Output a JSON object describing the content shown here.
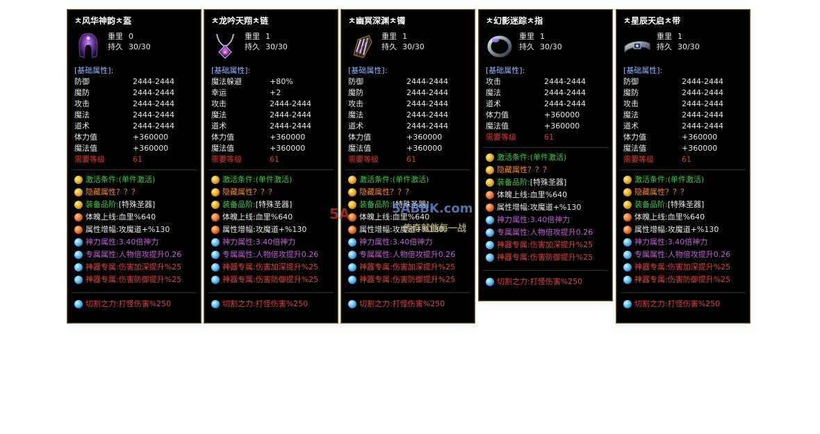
{
  "labels": {
    "weight": "重里",
    "durability": "持久",
    "base_header": "[基础属性]:"
  },
  "colors": {
    "panel_bg": "#000000",
    "border": "#7a5a28",
    "header": "#8fb4ff",
    "green": "#36d43c",
    "orange": "#ff8a1a",
    "purple": "#c75ae0",
    "red": "#e5423a"
  },
  "watermark": {
    "url": "5ABBK.com",
    "logo": "5A",
    "slogan": "传奇就能每一战"
  },
  "items": [
    {
      "title": "ㅊ风华神韵ㅊ盔",
      "icon": "helmet-icon",
      "weight": "0",
      "durability": "30/30",
      "base": [
        {
          "k": "防御",
          "v": "2444-2444"
        },
        {
          "k": "魔防",
          "v": "2444-2444"
        },
        {
          "k": "攻击",
          "v": "2444-2444"
        },
        {
          "k": "魔法",
          "v": "2444-2444"
        },
        {
          "k": "道术",
          "v": "2444-2444"
        },
        {
          "k": "体力值",
          "v": "+360000"
        },
        {
          "k": "魔法值",
          "v": "+360000"
        }
      ],
      "req": {
        "k": "需要等级",
        "v": "61"
      },
      "specials": [
        {
          "orb": "gold",
          "label": "激活条件:",
          "value": "(单件激活)",
          "lc": "c-green",
          "vc": "c-green"
        },
        {
          "orb": "gold",
          "label": "隐藏属性",
          "value": "？？？",
          "lc": "c-orange",
          "vc": "c-orange"
        },
        {
          "orb": "gold",
          "label": "装备品阶:",
          "value": "[特殊圣器]",
          "lc": "c-green",
          "vc": "c-white"
        },
        {
          "orb": "orange",
          "label": "体魄上线:",
          "value": "血里%640",
          "lc": "c-white",
          "vc": "c-white"
        },
        {
          "orb": "orange",
          "label": "属性增幅:",
          "value": "攻魔道+%130",
          "lc": "c-white",
          "vc": "c-white"
        },
        {
          "orb": "blue",
          "label": "神力属性:",
          "value": "3.40倍神力",
          "lc": "c-purple",
          "vc": "c-purple"
        },
        {
          "orb": "blue",
          "label": "专属属性:",
          "value": "人物倍攻提升0.26",
          "lc": "c-purple",
          "vc": "c-purple"
        },
        {
          "orb": "blue",
          "label": "神器专属:",
          "value": "伤害加深提升%25",
          "lc": "c-red",
          "vc": "c-red"
        },
        {
          "orb": "blue",
          "label": "神器专属:",
          "value": "伤害防御提升%25",
          "lc": "c-red",
          "vc": "c-red"
        }
      ],
      "cut": {
        "label": "切割之力:",
        "value": "打怪伤害%250"
      }
    },
    {
      "title": "ㅊ龙吟天翔ㅊ链",
      "icon": "necklace-icon",
      "weight": "1",
      "durability": "30/30",
      "base": [
        {
          "k": "魔法躲避",
          "v": "+80%"
        },
        {
          "k": "幸运",
          "v": "+2"
        },
        {
          "k": "攻击",
          "v": "2444-2444"
        },
        {
          "k": "魔法",
          "v": "2444-2444"
        },
        {
          "k": "道术",
          "v": "2444-2444"
        },
        {
          "k": "体力值",
          "v": "+360000"
        },
        {
          "k": "魔法值",
          "v": "+360000"
        }
      ],
      "req": {
        "k": "需要等级",
        "v": "61"
      },
      "specials": [
        {
          "orb": "gold",
          "label": "激活条件:",
          "value": "(单件激活)",
          "lc": "c-green",
          "vc": "c-green"
        },
        {
          "orb": "gold",
          "label": "隐藏属性",
          "value": "？？？",
          "lc": "c-orange",
          "vc": "c-orange"
        },
        {
          "orb": "gold",
          "label": "装备品阶:",
          "value": "[特殊圣器]",
          "lc": "c-green",
          "vc": "c-white"
        },
        {
          "orb": "orange",
          "label": "体魄上线:",
          "value": "血里%640",
          "lc": "c-white",
          "vc": "c-white"
        },
        {
          "orb": "orange",
          "label": "属性增幅:",
          "value": "攻魔道+%130",
          "lc": "c-white",
          "vc": "c-white"
        },
        {
          "orb": "blue",
          "label": "神力属性:",
          "value": "3.40倍神力",
          "lc": "c-purple",
          "vc": "c-purple"
        },
        {
          "orb": "blue",
          "label": "专属属性:",
          "value": "人物倍攻提升0.26",
          "lc": "c-purple",
          "vc": "c-purple"
        },
        {
          "orb": "blue",
          "label": "神器专属:",
          "value": "伤害加深提升%25",
          "lc": "c-red",
          "vc": "c-red"
        },
        {
          "orb": "blue",
          "label": "神器专属:",
          "value": "伤害防御提升%25",
          "lc": "c-red",
          "vc": "c-red"
        }
      ],
      "cut": {
        "label": "切割之力:",
        "value": "打怪伤害%250"
      }
    },
    {
      "title": "ㅊ幽冥深渊ㅊ镯",
      "icon": "bracelet-icon",
      "weight": "1",
      "durability": "30/30",
      "base": [
        {
          "k": "防御",
          "v": "2444-2444"
        },
        {
          "k": "魔防",
          "v": "2444-2444"
        },
        {
          "k": "攻击",
          "v": "2444-2444"
        },
        {
          "k": "魔法",
          "v": "2444-2444"
        },
        {
          "k": "道术",
          "v": "2444-2444"
        },
        {
          "k": "体力值",
          "v": "+360000"
        },
        {
          "k": "魔法值",
          "v": "+360000"
        }
      ],
      "req": {
        "k": "需要等级",
        "v": "61"
      },
      "specials": [
        {
          "orb": "gold",
          "label": "激活条件:",
          "value": "(单件激活)",
          "lc": "c-green",
          "vc": "c-green"
        },
        {
          "orb": "gold",
          "label": "隐藏属性",
          "value": "？？？",
          "lc": "c-orange",
          "vc": "c-orange"
        },
        {
          "orb": "gold",
          "label": "装备品阶:",
          "value": "[特殊圣器]",
          "lc": "c-green",
          "vc": "c-white"
        },
        {
          "orb": "orange",
          "label": "体魄上线:",
          "value": "血里%640",
          "lc": "c-white",
          "vc": "c-white"
        },
        {
          "orb": "orange",
          "label": "属性增幅:",
          "value": "攻魔道+%130",
          "lc": "c-white",
          "vc": "c-white"
        },
        {
          "orb": "blue",
          "label": "神力属性:",
          "value": "3.40倍神力",
          "lc": "c-purple",
          "vc": "c-purple"
        },
        {
          "orb": "blue",
          "label": "专属属性:",
          "value": "人物倍攻提升0.26",
          "lc": "c-purple",
          "vc": "c-purple"
        },
        {
          "orb": "blue",
          "label": "神器专属:",
          "value": "伤害加深提升%25",
          "lc": "c-red",
          "vc": "c-red"
        },
        {
          "orb": "blue",
          "label": "神器专属:",
          "value": "伤害防御提升%25",
          "lc": "c-red",
          "vc": "c-red"
        }
      ],
      "cut": {
        "label": "切割之力:",
        "value": "打怪伤害%250"
      }
    },
    {
      "title": "ㅊ幻影迷踪ㅊ指",
      "icon": "ring-icon",
      "weight": "1",
      "durability": "30/30",
      "base": [
        {
          "k": "攻击",
          "v": "2444-2444"
        },
        {
          "k": "魔法",
          "v": "2444-2444"
        },
        {
          "k": "道术",
          "v": "2444-2444"
        },
        {
          "k": "体力值",
          "v": "+360000"
        },
        {
          "k": "魔法值",
          "v": "+360000"
        }
      ],
      "req": {
        "k": "需要等级",
        "v": "61"
      },
      "specials": [
        {
          "orb": "gold",
          "label": "激活条件:",
          "value": "(单件激活)",
          "lc": "c-green",
          "vc": "c-green"
        },
        {
          "orb": "gold",
          "label": "隐藏属性",
          "value": "？？？",
          "lc": "c-orange",
          "vc": "c-orange"
        },
        {
          "orb": "gold",
          "label": "装备品阶:",
          "value": "[特殊圣器]",
          "lc": "c-green",
          "vc": "c-white"
        },
        {
          "orb": "orange",
          "label": "体魄上线:",
          "value": "血里%640",
          "lc": "c-white",
          "vc": "c-white"
        },
        {
          "orb": "orange",
          "label": "属性增幅:",
          "value": "攻魔道+%130",
          "lc": "c-white",
          "vc": "c-white"
        },
        {
          "orb": "blue",
          "label": "神力属性:",
          "value": "3.40倍神力",
          "lc": "c-purple",
          "vc": "c-purple"
        },
        {
          "orb": "blue",
          "label": "专属属性:",
          "value": "人物倍攻提升0.26",
          "lc": "c-purple",
          "vc": "c-purple"
        },
        {
          "orb": "blue",
          "label": "神器专属:",
          "value": "伤害加深提升%25",
          "lc": "c-red",
          "vc": "c-red"
        },
        {
          "orb": "blue",
          "label": "神器专属:",
          "value": "伤害防御提升%25",
          "lc": "c-red",
          "vc": "c-red"
        }
      ],
      "cut": {
        "label": "切割之力:",
        "value": "打怪伤害%250"
      }
    },
    {
      "title": "ㅊ星辰天启ㅊ带",
      "icon": "belt-icon",
      "weight": "1",
      "durability": "30/30",
      "base": [
        {
          "k": "防御",
          "v": "2444-2444"
        },
        {
          "k": "魔防",
          "v": "2444-2444"
        },
        {
          "k": "攻击",
          "v": "2444-2444"
        },
        {
          "k": "魔法",
          "v": "2444-2444"
        },
        {
          "k": "道术",
          "v": "2444-2444"
        },
        {
          "k": "体力值",
          "v": "+360000"
        },
        {
          "k": "魔法值",
          "v": "+360000"
        }
      ],
      "req": {
        "k": "需要等级",
        "v": "61"
      },
      "specials": [
        {
          "orb": "gold",
          "label": "激活条件:",
          "value": "(单件激活)",
          "lc": "c-green",
          "vc": "c-green"
        },
        {
          "orb": "gold",
          "label": "隐藏属性",
          "value": "？？？",
          "lc": "c-orange",
          "vc": "c-orange"
        },
        {
          "orb": "gold",
          "label": "装备品阶:",
          "value": "[特殊圣器]",
          "lc": "c-green",
          "vc": "c-white"
        },
        {
          "orb": "orange",
          "label": "体魄上线:",
          "value": "血里%640",
          "lc": "c-white",
          "vc": "c-white"
        },
        {
          "orb": "orange",
          "label": "属性增幅:",
          "value": "攻魔道+%130",
          "lc": "c-white",
          "vc": "c-white"
        },
        {
          "orb": "blue",
          "label": "神力属性:",
          "value": "3.40倍神力",
          "lc": "c-purple",
          "vc": "c-purple"
        },
        {
          "orb": "blue",
          "label": "专属属性:",
          "value": "人物倍攻提升0.26",
          "lc": "c-purple",
          "vc": "c-purple"
        },
        {
          "orb": "blue",
          "label": "神器专属:",
          "value": "伤害加深提升%25",
          "lc": "c-red",
          "vc": "c-red"
        },
        {
          "orb": "blue",
          "label": "神器专属:",
          "value": "伤害防御提升%25",
          "lc": "c-red",
          "vc": "c-red"
        }
      ],
      "cut": {
        "label": "切割之力:",
        "value": "打怪伤害%250"
      }
    }
  ]
}
